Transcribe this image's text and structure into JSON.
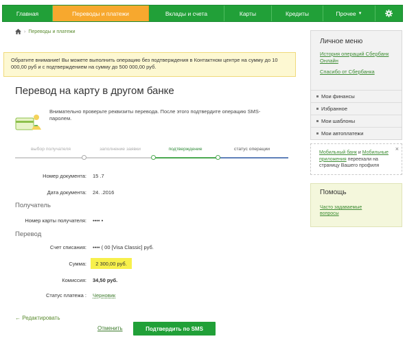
{
  "nav": {
    "items": [
      "Главная",
      "Переводы и платежи",
      "Вклады и счета",
      "Карты",
      "Кредиты",
      "Прочее"
    ],
    "active_index": 1,
    "accent": "#21a038",
    "active_color": "#f7a82e"
  },
  "breadcrumb": {
    "link": "Переводы и платежи"
  },
  "notice": {
    "text": "Обратите внимание! Вы можете выполнить операцию без подтверждения в Контактном центре на сумму до 10 000,00 руб и с подтверждением на сумму до 500 000,00 руб."
  },
  "page": {
    "title": "Перевод на карту в другом банке",
    "info_text": "Внимательно проверьте реквизиты перевода. После этого подтвердите операцию SMS-паролем."
  },
  "steps": [
    "выбор получателя",
    "заполнение заявки",
    "подтверждение",
    "статус операции"
  ],
  "form": {
    "doc_number_label": "Номер документа:",
    "doc_number_value": "15   .7",
    "doc_date_label": "Дата документа:",
    "doc_date_value": "24.   .2016",
    "recipient_section": "Получатель",
    "card_label": "Номер карты получателя:",
    "card_value": "••••    •",
    "transfer_section": "Перевод",
    "debit_label": "Счет списания:",
    "debit_value": "•••• (   00  [Visa Classic]  руб.",
    "amount_label": "Сумма:",
    "amount_value": "2 300,00   руб.",
    "fee_label": "Комиссия:",
    "fee_value": "34,50 руб.",
    "status_label": "Статус платежа :",
    "status_value": "Черновик"
  },
  "actions": {
    "edit": "← Редактировать",
    "cancel": "Отменить",
    "confirm": "Подтвердить по SMS"
  },
  "sidebar": {
    "heading": "Личное меню",
    "links": [
      "История операций Сбербанк Онлайн",
      "Спасибо от Сбербанка"
    ],
    "menu": [
      "Мои финансы",
      "Избранное",
      "Мои шаблоны",
      "Мои автоплатежи"
    ],
    "note_link1": "Мобильный банк",
    "note_and": " и ",
    "note_link2": "Мобильные приложения",
    "note_rest": " переехали на страницу Вашего профиля",
    "help_heading": "Помощь",
    "help_link": "Часто задаваемые вопросы"
  }
}
